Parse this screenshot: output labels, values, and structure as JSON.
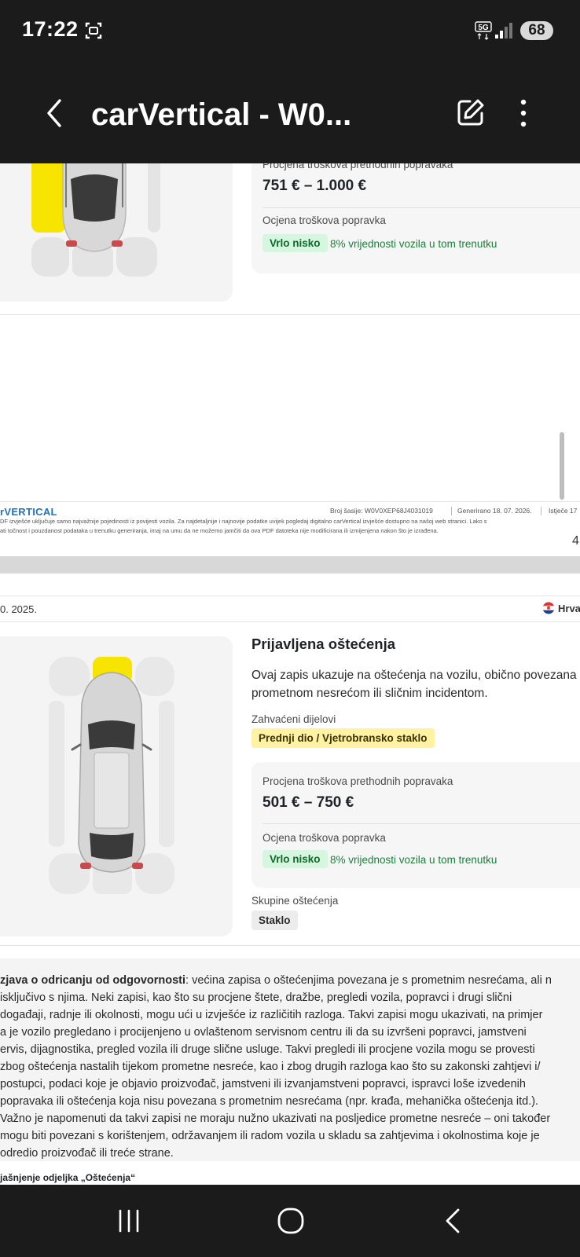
{
  "status_bar": {
    "time": "17:22",
    "network": "5G",
    "battery": "68"
  },
  "app_bar": {
    "title": "carVertical - W0...",
    "icons": [
      "back-arrow-icon",
      "edit-icon",
      "more-vertical-icon"
    ]
  },
  "damage_card_1": {
    "previous_repair_cost_label": "Procjena troškova prethodnih popravaka",
    "previous_repair_cost": "751 € – 1.000 €",
    "repair_cost_rating_label": "Ocjena troškova popravka",
    "rating_badge": "Vrlo nisko",
    "rating_note": "8% vrijednosti vozila u tom trenutku"
  },
  "page_footer": {
    "logo": "rVERTICAL",
    "vin": "Broj šasije:  W0V0XEP68J4031019",
    "generated": "Generirano  18. 07. 2026.",
    "expires": "Istječe  17",
    "note_line_1": "DF izvješće uključuje samo najvažnije pojedinosti iz povijesti vozila. Za najdetaljnije i najnovije podatke uvijek pogledaj digitalno carVertical izvješće dostupno na našoj web stranici. Lako s",
    "note_line_2": "ati točnost i pouzdanost podataka u trenutku generiranja, imaj na umu da ne možemo jamčiti da ova PDF datoteka nije modificirana ili izmijenjena nakon što je izrađena.",
    "page_number": "4"
  },
  "page_header": {
    "date": "0. 2025.",
    "country": "Hrva"
  },
  "damage_card_2": {
    "title": "Prijavljena oštećenja",
    "description": [
      "Ovaj zapis ukazuje na oštećenja na vozilu, obično povezana",
      "prometnom nesrećom ili sličnim incidentom."
    ],
    "affected_parts_label": "Zahvaćeni dijelovi",
    "affected_part": "Prednji dio / Vjetrobransko staklo",
    "previous_repair_cost_label": "Procjena troškova prethodnih popravaka",
    "previous_repair_cost": "501 € – 750 €",
    "repair_cost_rating_label": "Ocjena troškova popravka",
    "rating_badge": "Vrlo nisko",
    "rating_note": "8% vrijednosti vozila u tom trenutku",
    "damage_groups_label": "Skupine oštećenja",
    "damage_group": "Staklo"
  },
  "disclaimer": {
    "heading": "zjava o odricanju od odgovornosti",
    "first_line_rest": ": većina zapisa o oštećenjima povezana je s prometnim nesrećama, ali n",
    "lines": [
      "isključivo s njima. Neki zapisi, kao što su procjene štete, dražbe, pregledi vozila, popravci i drugi slični",
      "događaji, radnje ili okolnosti, mogu ući u izvješće iz različitih razloga. Takvi zapisi mogu ukazivati, na primjer",
      "a je vozilo pregledano i procijenjeno u ovlaštenom servisnom centru ili da su izvršeni popravci, jamstveni",
      "ervis, dijagnostika, pregled vozila ili druge slične usluge. Takvi pregledi ili procjene vozila mogu se provesti",
      "zbog oštećenja nastalih tijekom prometne nesreće, kao i zbog drugih razloga kao što su zakonski zahtjevi i/",
      "postupci, podaci koje je objavio proizvođač, jamstveni ili izvanjamstveni popravci, ispravci loše izvedenih",
      "popravaka ili oštećenja koja nisu povezana s prometnim nesrećama (npr. krađa, mehanička oštećenja itd.).",
      "Važno je napomenuti da takvi zapisi ne moraju nužno ukazivati na posljedice prometne nesreće – oni također",
      "mogu biti povezani s korištenjem, održavanjem ili radom vozila u skladu sa zahtjevima i okolnostima koje je",
      "odredio proizvođač ili treće strane."
    ]
  },
  "section_explanation": "jašnjenje odjeljka „Oštećenja“",
  "colors": {
    "accent_blue": "#1a73c9",
    "badge_green_bg": "#d6f6df",
    "badge_yellow_bg": "#fff2a3",
    "damage_highlight": "#f7e400"
  }
}
